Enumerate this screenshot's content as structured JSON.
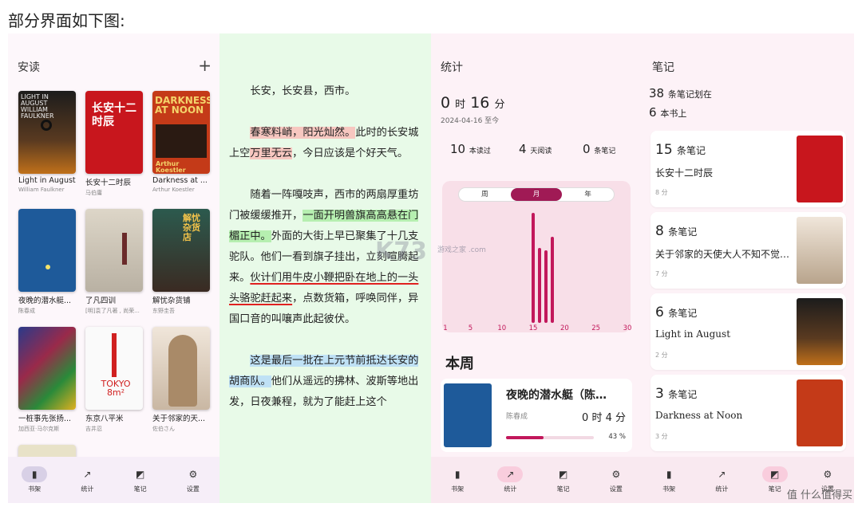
{
  "intro": "部分界面如下图:",
  "bookshelf": {
    "title": "安读",
    "books": [
      {
        "title": "Light in August",
        "author": "William Faulkner"
      },
      {
        "title": "长安十二时辰",
        "author": "马伯庸"
      },
      {
        "title": "Darkness at ...",
        "author": "Arthur Koestler"
      },
      {
        "title": "夜晚的潜水艇...",
        "author": "陈春成"
      },
      {
        "title": "了凡四训",
        "author": "[明]袁了凡著 , 尚荣..."
      },
      {
        "title": "解忧杂货铺",
        "author": "东野圭吾"
      },
      {
        "title": "一桩事先张扬...",
        "author": "加西亚·马尔克斯"
      },
      {
        "title": "东京八平米",
        "author": "吉井忍"
      },
      {
        "title": "关于邻家的天...",
        "author": "佐伯さん"
      }
    ],
    "covers": {
      "light": "LIGHT IN AUGUST WILLIAM FAULKNER",
      "changan": "长安十二时辰",
      "darkness": "DARKNESS AT NOON",
      "darkness_author": "Arthur Koestler",
      "jieyou": "解忧杂货店",
      "tokyo": "TOKYO 8m²"
    }
  },
  "nav": {
    "shelf": "书架",
    "stats": "统计",
    "notes": "笔记",
    "settings": "设置"
  },
  "reader": {
    "p1": "长安，长安县，西市。",
    "p2a": "春寒料峭，阳光灿然。",
    "p2b": "此时的长安城上空",
    "p2c": "万里无云",
    "p2d": "，今日应该是个好天气。",
    "p3a": "随着一阵嘎吱声，西市的两扇厚重坊门被缓缓推开，",
    "p3b": "一面开明兽旗高高悬在门楣正中。",
    "p3c": "外面的大街上早已聚集了十几支驼队。他们一看到旗子挂出，立刻喧腾起来。",
    "p3d": "伙计们用牛皮小鞭把卧在地上的一头头骆驼赶起来",
    "p3e": "，点数货箱，呼唤同伴，异国口音的叫嚷声此起彼伏。",
    "p4a": "这是最后一批在上元节前抵达长安的胡商队。",
    "p4b": "他们从遥远的拂林、波斯等地出发，日夜兼程，就为了能赶上这个"
  },
  "stats": {
    "title": "统计",
    "time_h": "0",
    "time_h_unit": "时",
    "time_m": "16",
    "time_m_unit": "分",
    "since": "2024-04-16 至今",
    "read_count": "10",
    "read_label": "本读过",
    "days": "4",
    "days_label": "天阅读",
    "notes": "0",
    "notes_label": "条笔记",
    "tabs": [
      "周",
      "月",
      "年"
    ],
    "this_week": "本周",
    "book_title": "夜晚的潜水艇（陈…",
    "book_author": "陈春成",
    "book_time": "0 时 4 分",
    "book_percent": "43 %",
    "progress": 0.43
  },
  "chart_data": {
    "type": "bar",
    "x": [
      15,
      16,
      17,
      18
    ],
    "values": [
      100,
      68,
      66,
      78
    ],
    "xticks": [
      "1",
      "5",
      "10",
      "15",
      "20",
      "25",
      "30"
    ],
    "xlim": [
      1,
      30
    ],
    "color": "#c2185b"
  },
  "notes": {
    "title": "笔记",
    "total": "38",
    "total_label": "条笔记划在",
    "books": "6",
    "books_label": "本书上",
    "items": [
      {
        "count": "15",
        "label": "条笔记",
        "title": "长安十二时辰",
        "time": "8 分"
      },
      {
        "count": "8",
        "label": "条笔记",
        "title": "关于邻家的天使大人不知不觉…",
        "time": "7 分"
      },
      {
        "count": "6",
        "label": "条笔记",
        "title": "Light in August",
        "time": "2 分"
      },
      {
        "count": "3",
        "label": "条笔记",
        "title": "Darkness at Noon",
        "time": "3 分"
      }
    ]
  },
  "watermark": "K73",
  "watermark_sub": "游戏之家 .com",
  "corner_brand": "值 什么值得买"
}
